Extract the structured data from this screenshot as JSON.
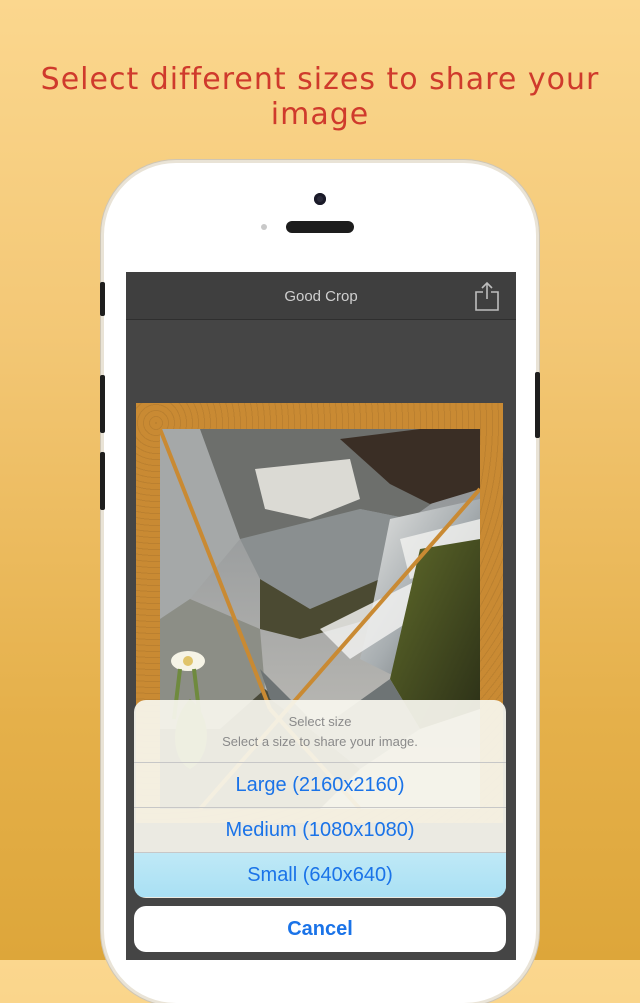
{
  "promo": {
    "headline": "Select different sizes to share your image"
  },
  "app": {
    "title": "Good Crop",
    "share_icon": "share-icon"
  },
  "action_sheet": {
    "title": "Select size",
    "subtitle": "Select a size to share your image.",
    "options": [
      {
        "label": "Large (2160x2160)"
      },
      {
        "label": "Medium (1080x1080)"
      },
      {
        "label": "Small (640x640)",
        "selected": true
      }
    ],
    "cancel_label": "Cancel"
  },
  "colors": {
    "accent": "#1a73e8",
    "headline": "#cf3a2c",
    "frame": "#c98a33",
    "navbar": "#3f3f3f"
  }
}
